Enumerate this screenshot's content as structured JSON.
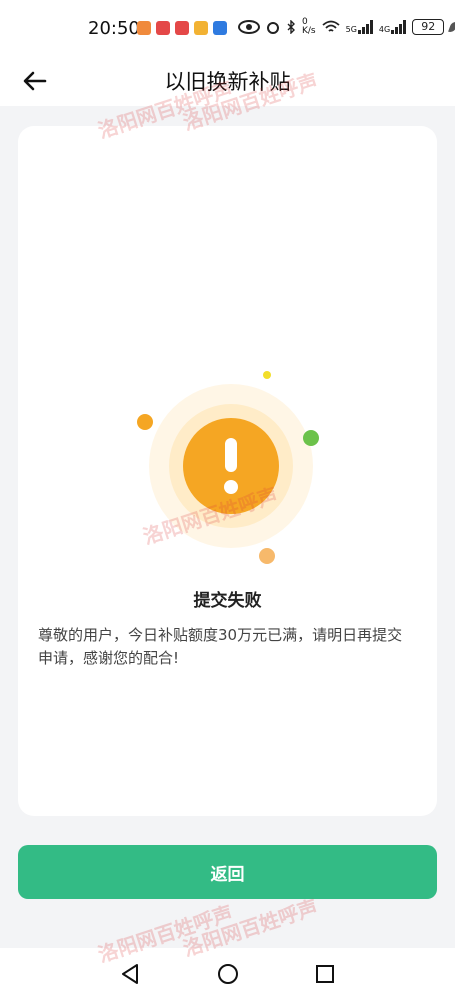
{
  "status_bar": {
    "time": "20:50",
    "network_speed_top": "0",
    "network_speed_unit": "K/s",
    "signal_label_1": "5G",
    "signal_label_2": "4G",
    "battery": "92"
  },
  "header": {
    "title": "以旧换新补贴"
  },
  "result": {
    "title": "提交失败",
    "message": "尊敬的用户，今日补贴额度30万元已满，请明日再提交申请，感谢您的配合!"
  },
  "footer": {
    "return_label": "返回"
  },
  "watermarks": {
    "text_1": "洛阳网",
    "text_2": "百姓呼声"
  },
  "colors": {
    "primary_green": "#33bb85",
    "warning_orange": "#f5a623",
    "accent_green": "#6cc24a",
    "accent_yellow": "#f2de2a"
  },
  "icons": {
    "back": "arrow-left-icon",
    "warning": "exclamation-icon",
    "nav_back": "triangle-back-icon",
    "nav_home": "circle-home-icon",
    "nav_recent": "square-recent-icon"
  }
}
